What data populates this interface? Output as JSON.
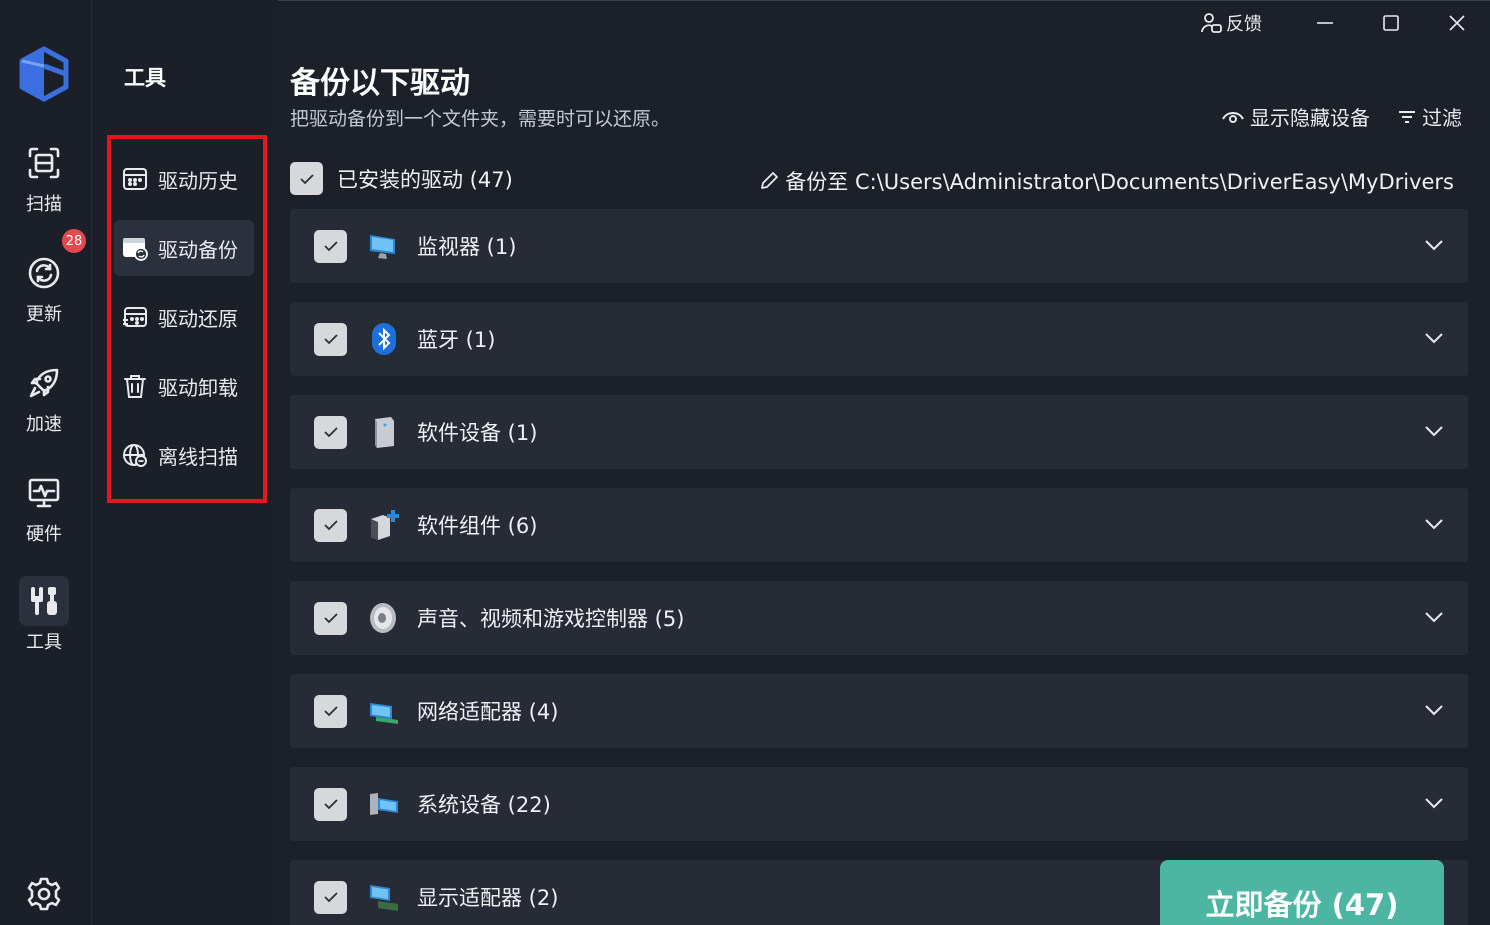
{
  "titlebar": {
    "feedback_label": "反馈"
  },
  "rail": {
    "items": [
      {
        "label": "扫描",
        "icon": "scan-icon"
      },
      {
        "label": "更新",
        "icon": "update-icon"
      },
      {
        "label": "加速",
        "icon": "rocket-icon"
      },
      {
        "label": "硬件",
        "icon": "hardware-icon"
      },
      {
        "label": "工具",
        "icon": "tools-icon"
      }
    ],
    "update_badge": "28",
    "active": "工具"
  },
  "tools": {
    "title": "工具",
    "items": [
      {
        "label": "驱动历史",
        "icon": "history-icon"
      },
      {
        "label": "驱动备份",
        "icon": "backup-icon"
      },
      {
        "label": "驱动还原",
        "icon": "restore-icon"
      },
      {
        "label": "驱动卸载",
        "icon": "trash-icon"
      },
      {
        "label": "离线扫描",
        "icon": "offline-scan-icon"
      }
    ],
    "active": "驱动备份"
  },
  "main": {
    "title": "备份以下驱动",
    "subtitle": "把驱动备份到一个文件夹，需要时可以还原。",
    "show_hidden_label": "显示隐藏设备",
    "filter_label": "过滤",
    "select_all_label": "已安装的驱动 (47)",
    "backup_path_label": "备份至 C:\\Users\\Administrator\\Documents\\DriverEasy\\MyDrivers",
    "categories": [
      {
        "name": "监视器 (1)",
        "icon": "monitor-icon",
        "checked": true
      },
      {
        "name": "蓝牙 (1)",
        "icon": "bluetooth-icon",
        "checked": true
      },
      {
        "name": "软件设备 (1)",
        "icon": "software-device-icon",
        "checked": true
      },
      {
        "name": "软件组件 (6)",
        "icon": "software-component-icon",
        "checked": true
      },
      {
        "name": "声音、视频和游戏控制器 (5)",
        "icon": "speaker-icon",
        "checked": true
      },
      {
        "name": "网络适配器 (4)",
        "icon": "network-adapter-icon",
        "checked": true
      },
      {
        "name": "系统设备 (22)",
        "icon": "system-device-icon",
        "checked": true
      },
      {
        "name": "显示适配器 (2)",
        "icon": "display-adapter-icon",
        "checked": true
      }
    ],
    "cta_label": "立即备份 (47)"
  },
  "colors": {
    "background": "#1b2029",
    "row": "#262b36",
    "accent": "#4cb6a2",
    "highlight_border": "#e8141c",
    "badge": "#e5484d",
    "logo": "#3b6fe0"
  }
}
